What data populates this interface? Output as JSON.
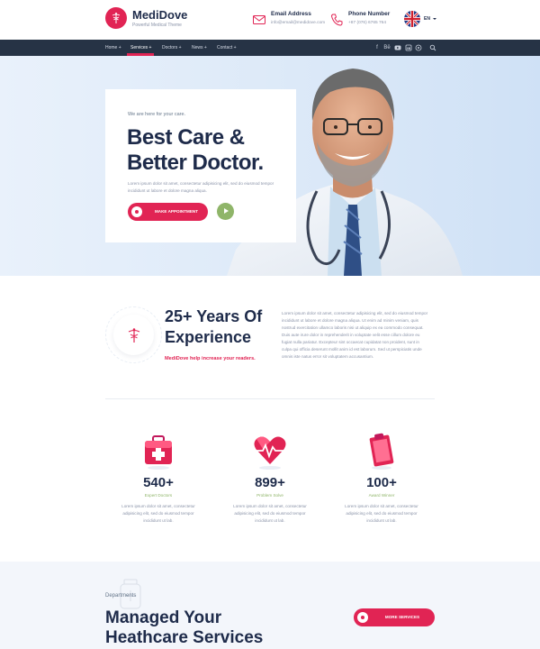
{
  "brand": {
    "name": "MediDove",
    "tagline": "Powerful Medical Theme"
  },
  "contact": {
    "email_title": "Email Address",
    "email_value": "info@email@medidove.com",
    "phone_title": "Phone Number",
    "phone_value": "+87 (076) 6765 764"
  },
  "language": {
    "code": "EN"
  },
  "nav": {
    "items": [
      {
        "label": "Home +"
      },
      {
        "label": "Services +"
      },
      {
        "label": "Doctors +"
      },
      {
        "label": "News +"
      },
      {
        "label": "Contact +"
      }
    ],
    "social_icons": [
      "facebook-icon",
      "behance-icon",
      "youtube-icon",
      "linkedin-icon",
      "pinterest-icon",
      "search-icon"
    ]
  },
  "hero": {
    "eyebrow": "We are here for your care.",
    "title_line1": "Best Care &",
    "title_line2": "Better Doctor.",
    "text": "Lorem ipsum dolor sit amet, consectetur adipisicing elit, sed do eiusmod tempor incididunt ut labore et dolore magna aliqua.",
    "cta_label": "MAKE APPOINTMENT"
  },
  "experience": {
    "title_line1": "25+ Years Of",
    "title_line2": "Experience",
    "tagline": "MediDove help increase your readers.",
    "text": "Lorem ipsum dolor sit amet, consectetur adipisicing elit, sed do eiusmod tempor incididunt ut labore et dolore magna aliqua. Ut enim ad minim veniam, quis nostrud exercitation ullamco laboris nisi ut aliquip ex ea commodo consequat. Duis aute irure dolor in reprehenderit in voluptate velit esse cillum dolore eu fugiat nulla pariatur. Excepteur sint occaecat cupidatat non proident, sunt in culpa qui officia deserunt mollit anim id est laborum. Sed ut perspiciatis unde omnis iste natus error sit voluptatem accusantium."
  },
  "stats": [
    {
      "icon": "medical-kit-icon",
      "value": "540+",
      "label": "Expert Doctors",
      "text": "Lorem ipsum dolor sit amet, consectetur adipisicing elit, sed do eiusmod tempor incididunt ut lab."
    },
    {
      "icon": "heartbeat-icon",
      "value": "899+",
      "label": "Problem Solve",
      "text": "Lorem ipsum dolor sit amet, consectetur adipisicing elit, sed do eiusmod tempor incididunt ut lab."
    },
    {
      "icon": "clipboard-icon",
      "value": "100+",
      "label": "Award Winner",
      "text": "Lorem ipsum dolor sit amet, consectetur adipisicing elit, sed do eiusmod tempor incididunt ut lab."
    }
  ],
  "departments": {
    "eyebrow": "Departments",
    "title_line1": "Managed Your",
    "title_line2": "Heathcare Services",
    "button_label": "MORE SERVICES"
  },
  "colors": {
    "accent": "#e12454",
    "navy": "#1e2b4a",
    "nav_bg": "#263345",
    "green": "#8fb569"
  }
}
